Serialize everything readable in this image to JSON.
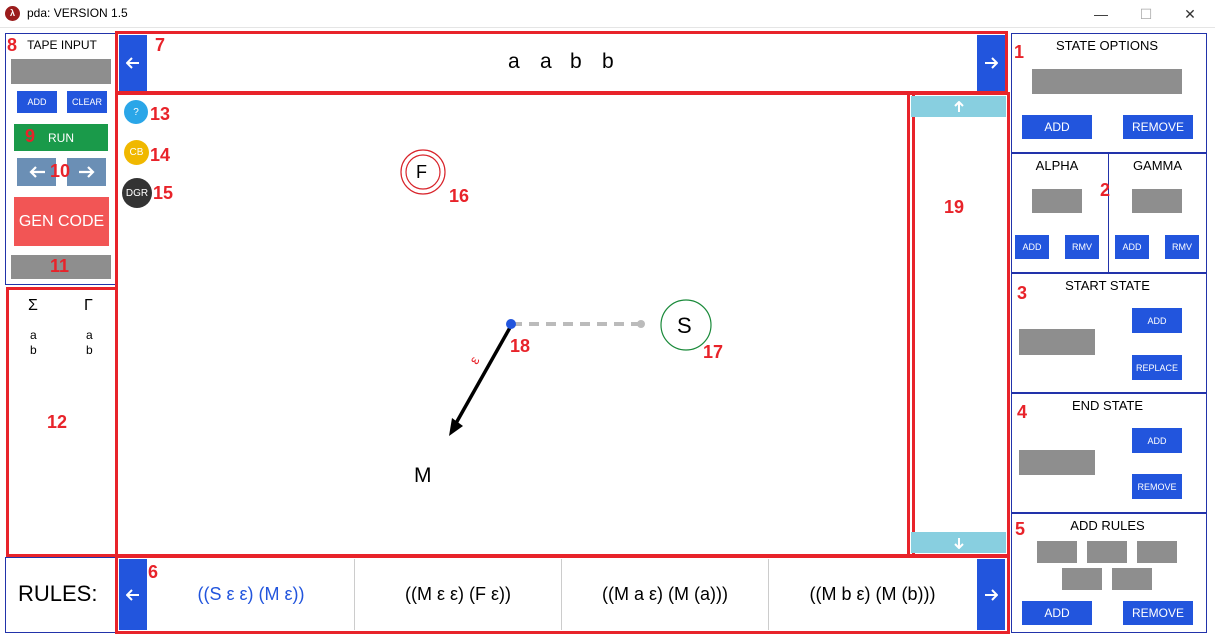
{
  "window": {
    "title": "pda: VERSION 1.5",
    "min": "—",
    "max": "☐",
    "close": "✕"
  },
  "tape_input": {
    "title": "TAPE INPUT",
    "add": "ADD",
    "clear": "CLEAR",
    "run": "RUN",
    "gen_code": "GEN CODE"
  },
  "tape": {
    "symbols": [
      "a",
      "a",
      "b",
      "b"
    ]
  },
  "alphabet": {
    "sigma_header": "Σ",
    "gamma_header": "Γ",
    "sigma": [
      "a",
      "b"
    ],
    "gamma": [
      "a",
      "b"
    ]
  },
  "canvas_buttons": {
    "help": "?",
    "cb": "CB",
    "dgr": "DGR"
  },
  "states": {
    "final": "F",
    "start": "S",
    "middle": "M",
    "transition_label": "ε"
  },
  "state_options": {
    "title": "STATE OPTIONS",
    "add": "ADD",
    "remove": "REMOVE"
  },
  "alpha_gamma": {
    "alpha": "ALPHA",
    "gamma": "GAMMA",
    "add1": "ADD",
    "rmv1": "RMV",
    "add2": "ADD",
    "rmv2": "RMV"
  },
  "start_state": {
    "title": "START STATE",
    "add": "ADD",
    "replace": "REPLACE"
  },
  "end_state": {
    "title": "END STATE",
    "add": "ADD",
    "remove": "REMOVE"
  },
  "add_rules": {
    "title": "ADD RULES",
    "add": "ADD",
    "remove": "REMOVE"
  },
  "rules": {
    "label": "RULES:",
    "items": [
      "((S ε ε) (M ε))",
      "((M ε ε) (F ε))",
      "((M a ε) (M (a)))",
      "((M b ε) (M (b)))"
    ]
  },
  "annotations": {
    "n1": "1",
    "n2": "2",
    "n3": "3",
    "n4": "4",
    "n5": "5",
    "n6": "6",
    "n7": "7",
    "n8": "8",
    "n9": "9",
    "n10": "10",
    "n11": "11",
    "n12": "12",
    "n13": "13",
    "n14": "14",
    "n15": "15",
    "n16": "16",
    "n17": "17",
    "n18": "18",
    "n19": "19"
  },
  "colors": {
    "accent_blue": "#2255dd",
    "annotation_red": "#e8232a",
    "run_green": "#1a9a4a",
    "gen_code_red": "#f25555",
    "grey_field": "#8e8e8e",
    "scroll_cyan": "#88cfe0",
    "help_blue": "#2aa6e8",
    "cb_yellow": "#f0b800",
    "dgr_dark": "#333333",
    "final_red": "#d8232a",
    "start_green": "#1a8a3a"
  },
  "icons": {
    "left_arrow": "left-arrow-icon",
    "right_arrow": "right-arrow-icon",
    "up_arrow": "up-arrow-icon",
    "down_arrow": "down-arrow-icon"
  }
}
